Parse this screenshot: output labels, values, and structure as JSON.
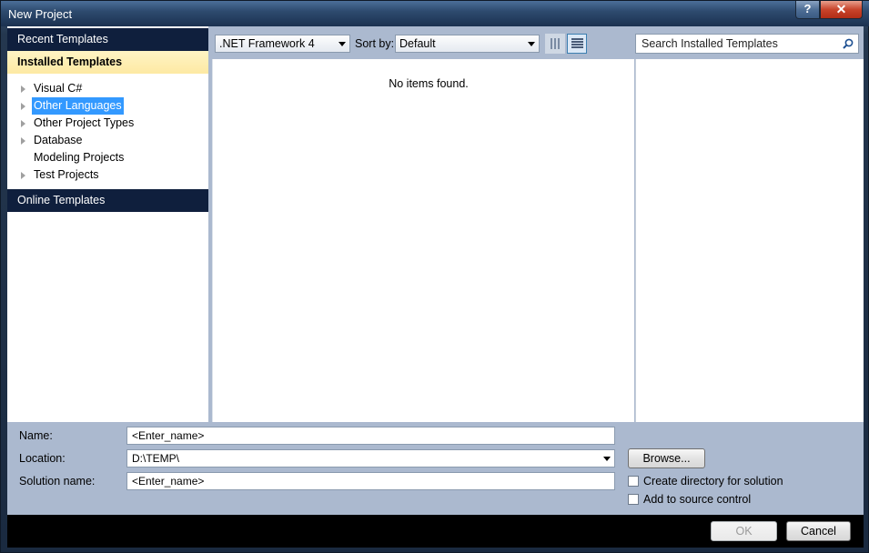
{
  "window": {
    "title": "New Project",
    "help_label": "?",
    "close_label": "✕"
  },
  "left": {
    "recent_label": "Recent Templates",
    "installed_label": "Installed Templates",
    "online_label": "Online Templates",
    "tree": [
      {
        "label": "Visual C#",
        "expandable": true,
        "selected": false
      },
      {
        "label": "Other Languages",
        "expandable": true,
        "selected": true
      },
      {
        "label": "Other Project Types",
        "expandable": true,
        "selected": false
      },
      {
        "label": "Database",
        "expandable": true,
        "selected": false
      },
      {
        "label": "Modeling Projects",
        "expandable": false,
        "selected": false
      },
      {
        "label": "Test Projects",
        "expandable": true,
        "selected": false
      }
    ]
  },
  "toolbar": {
    "framework_value": ".NET Framework 4",
    "sort_label": "Sort by:",
    "sort_value": "Default",
    "search_placeholder": "Search Installed Templates"
  },
  "center": {
    "empty_message": "No items found."
  },
  "form": {
    "name_label": "Name:",
    "name_value": "<Enter_name>",
    "location_label": "Location:",
    "location_value": "D:\\TEMP\\",
    "solution_label": "Solution name:",
    "solution_value": "<Enter_name>",
    "browse_label": "Browse...",
    "create_dir_label": "Create directory for solution",
    "source_control_label": "Add to source control"
  },
  "footer": {
    "ok_label": "OK",
    "cancel_label": "Cancel"
  },
  "colors": {
    "selection": "#3399ff",
    "header_dark": "#0f1f3d",
    "installed_highlight": "#fde9a3",
    "client_bg": "#abb9cf"
  }
}
